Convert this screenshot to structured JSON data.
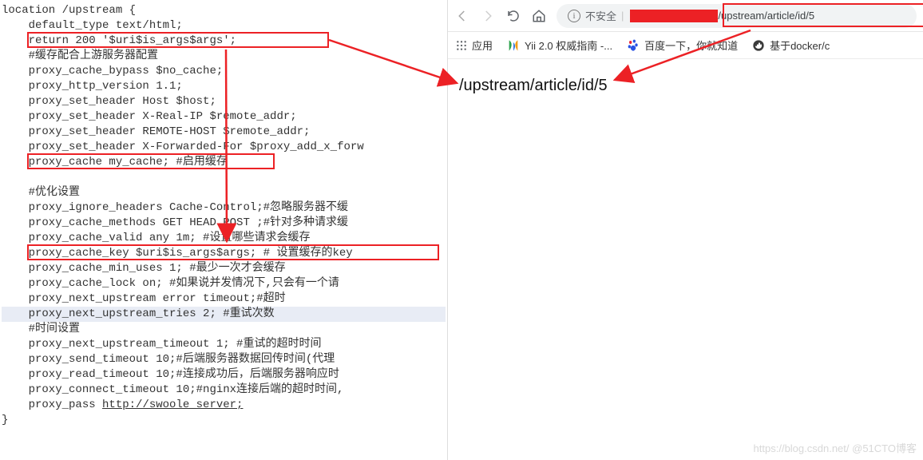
{
  "code": {
    "lines_pre": "location /upstream {\n    default_type text/html;\n    return 200 '$uri$is_args$args';\n    #缓存配合上游服务器配置\n    proxy_cache_bypass $no_cache;\n    proxy_http_version 1.1;\n    proxy_set_header Host $host;\n    proxy_set_header X-Real-IP $remote_addr;\n    proxy_set_header REMOTE-HOST $remote_addr;\n    proxy_set_header X-Forwarded-For $proxy_add_x_forw\n    proxy_cache my_cache; #启用缓存\n\n    #优化设置\n    proxy_ignore_headers Cache-Control;#忽略服务器不缓\n    proxy_cache_methods GET HEAD POST ;#针对多种请求缓\n    proxy_cache_valid any 1m; #设置哪些请求会缓存\n    proxy_cache_key $uri$is_args$args; # 设置缓存的key\n    proxy_cache_min_uses 1; #最少一次才会缓存\n    proxy_cache_lock on; #如果说并发情况下,只会有一个请\n    proxy_next_upstream error timeout;#超时",
    "hl_line": "    proxy_next_upstream_tries 2; #重试次数",
    "lines_post1": "\n    #时间设置\n    proxy_next_upstream_timeout 1; #重试的超时时间\n    proxy_send_timeout 10;#后端服务器数据回传时间(代理\n    proxy_read_timeout 10;#连接成功后，后端服务器响应时\n    proxy_connect_timeout 10;#nginx连接后端的超时时间,\n    proxy_pass ",
    "proxy_pass_url": "http://swoole_server;",
    "lines_post2": "\n}"
  },
  "browser": {
    "insecure_label": "不安全",
    "url_path": "/upstream/article/id/5",
    "bookmarks": {
      "apps": "应用",
      "yii": "Yii 2.0 权威指南 -...",
      "baidu": "百度一下，你就知道",
      "docker": "基于docker/c"
    }
  },
  "page": {
    "body_text": "/upstream/article/id/5"
  },
  "watermark": "https://blog.csdn.net/  @51CTO博客"
}
